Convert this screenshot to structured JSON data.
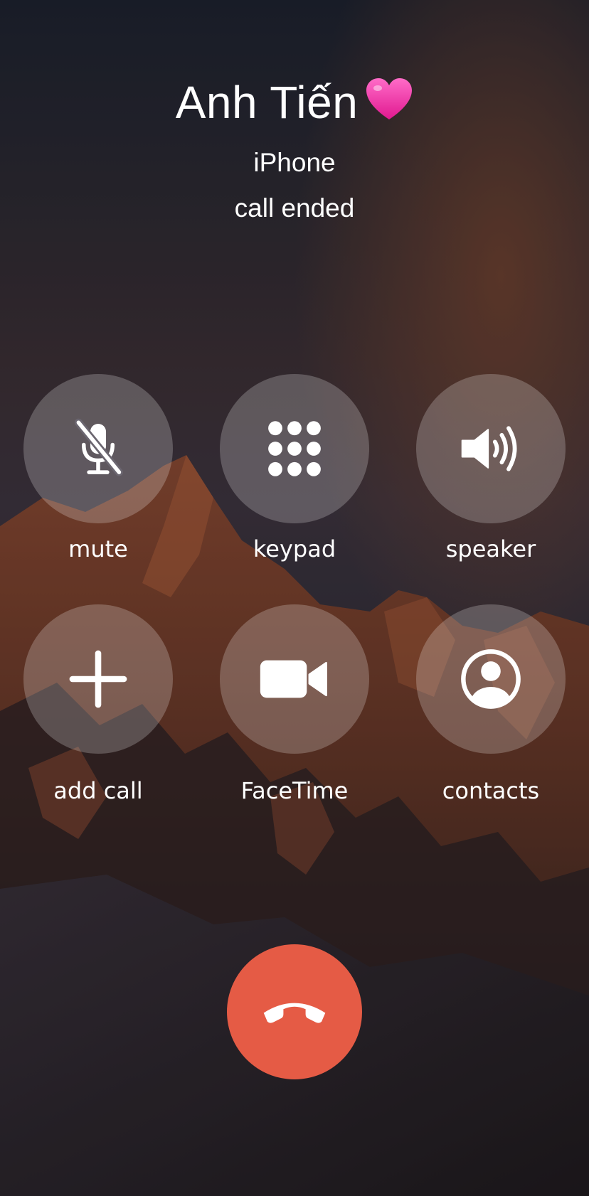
{
  "call": {
    "caller_name": "Anh Tiến",
    "caller_emoji": "heart-emoji",
    "caller_device": "iPhone",
    "status": "call ended"
  },
  "controls": {
    "mute_label": "mute",
    "keypad_label": "keypad",
    "speaker_label": "speaker",
    "add_call_label": "add call",
    "facetime_label": "FaceTime",
    "contacts_label": "contacts"
  },
  "icons": {
    "mute": "mic-slash-icon",
    "keypad": "keypad-grid-icon",
    "speaker": "speaker-wave-icon",
    "add_call": "plus-icon",
    "facetime": "video-camera-icon",
    "contacts": "person-circle-icon",
    "end_call": "phone-hangup-icon"
  },
  "colors": {
    "end_call": "#e55b45",
    "heart": "#f53fb0",
    "text": "#ffffff"
  }
}
